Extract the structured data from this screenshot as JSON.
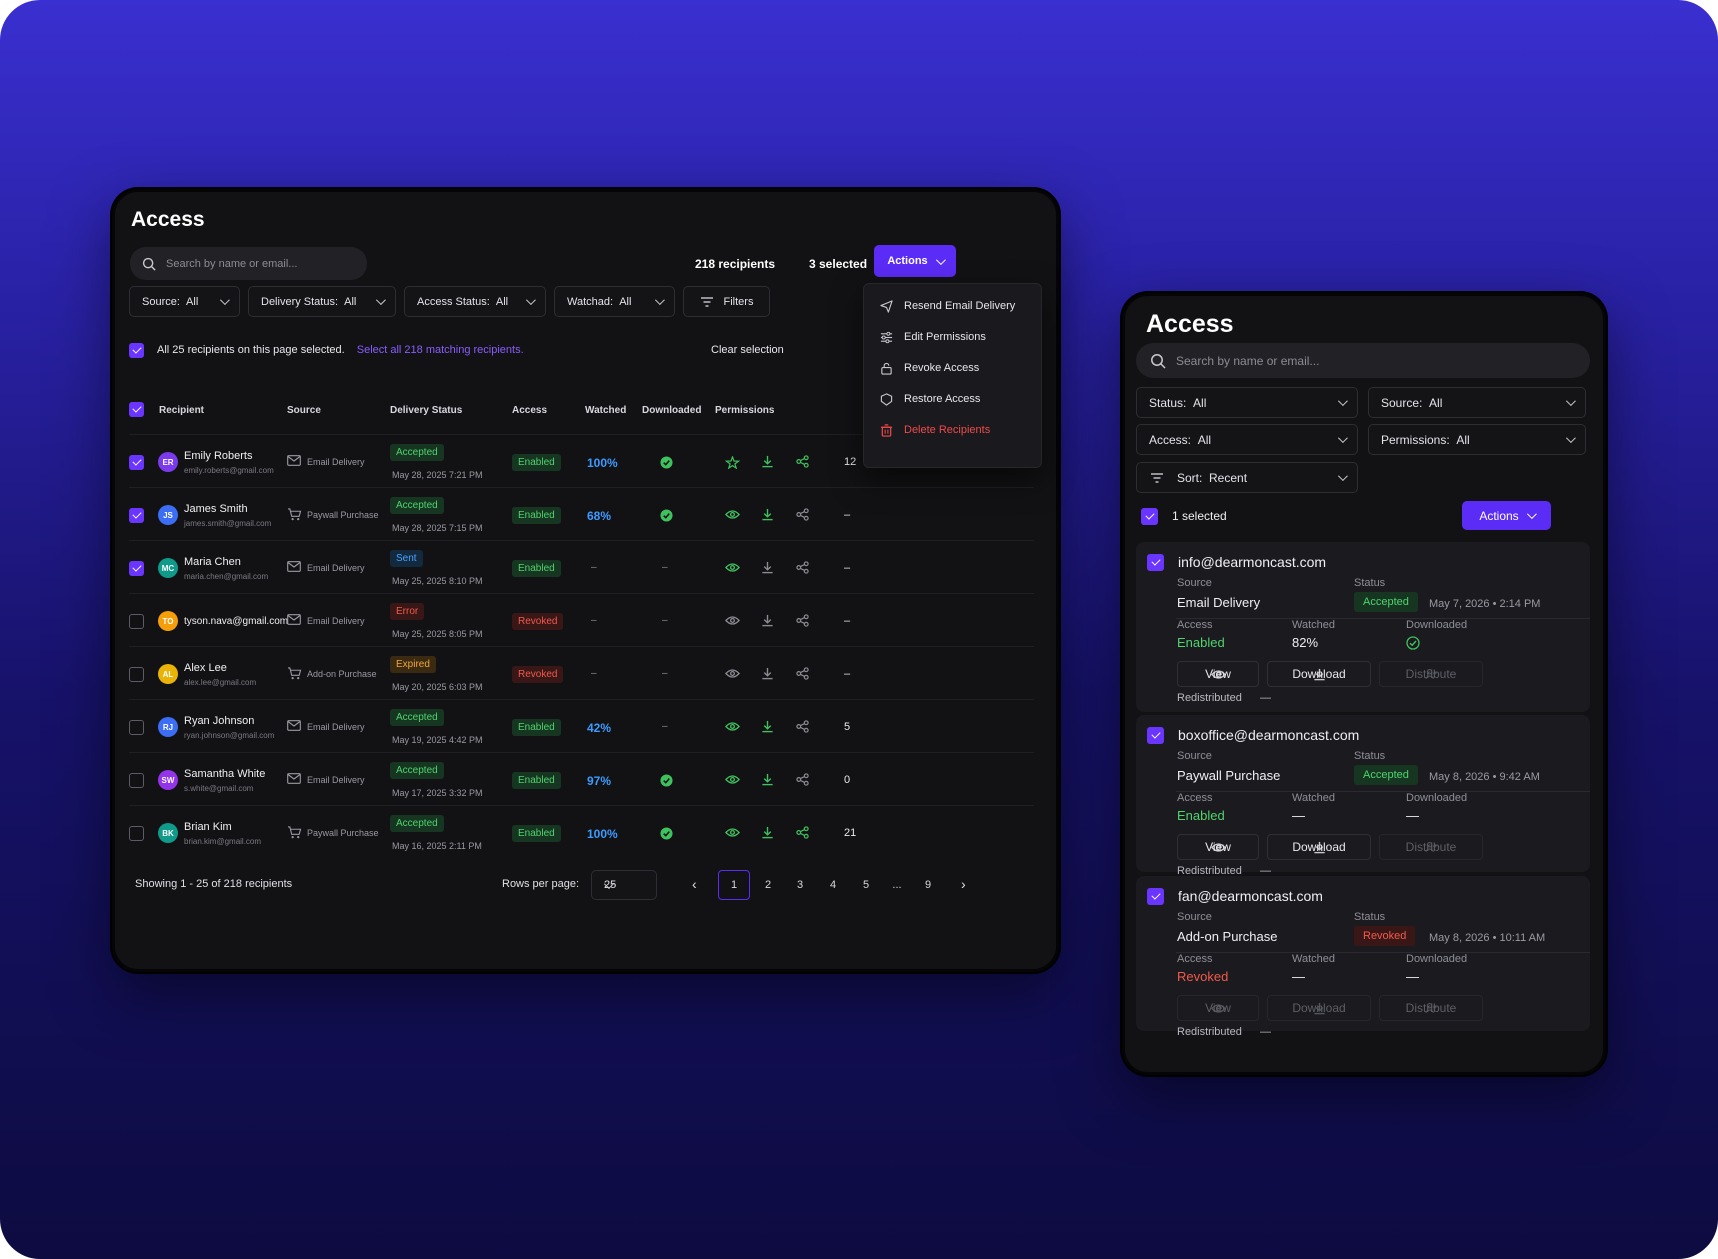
{
  "colors": {
    "accent": "#5b2cf5",
    "success": "#4fd36d",
    "danger": "#f05a4c",
    "info": "#4aa3ff",
    "warning": "#f0a53a"
  },
  "desktop": {
    "title": "Access",
    "search_placeholder": "Search by name or email...",
    "recipients_count": "218 recipients",
    "selected_count": "3 selected",
    "actions_label": "Actions",
    "filters": [
      {
        "label": "Source:",
        "value": "All"
      },
      {
        "label": "Delivery Status:",
        "value": "All"
      },
      {
        "label": "Access Status:",
        "value": "All"
      },
      {
        "label": "Watchad:",
        "value": "All"
      }
    ],
    "filters_button": "Filters",
    "selection_text": "All 25 recipients on this page selected.",
    "select_all_link": "Select all 218 matching recipients.",
    "clear_selection": "Clear selection",
    "menu": [
      {
        "label": "Resend Email Delivery",
        "icon": "send-icon"
      },
      {
        "label": "Edit Permissions",
        "icon": "sliders-icon"
      },
      {
        "label": "Revoke Access",
        "icon": "lock-open-icon"
      },
      {
        "label": "Restore Access",
        "icon": "shield-icon"
      },
      {
        "label": "Delete Recipients",
        "icon": "trash-icon"
      }
    ],
    "columns": [
      "Recipient",
      "Source",
      "Delivery Status",
      "Access",
      "Watched",
      "Downloaded",
      "Permissions"
    ],
    "rows": [
      {
        "initials": "ER",
        "avatar_color": "#7c3aed",
        "name": "Emily Roberts",
        "email": "emily.roberts@gmail.com",
        "source": "Email Delivery",
        "source_icon": "mail-icon",
        "status": "Accepted",
        "status_kind": "green",
        "date": "May 28, 2025 7:21 PM",
        "access": "Enabled",
        "access_kind": "green",
        "watched": "100%",
        "downloaded": "check",
        "perm_kind": "share-active",
        "count": "12",
        "checked": true
      },
      {
        "initials": "JS",
        "avatar_color": "#3b6ef5",
        "name": "James Smith",
        "email": "james.smith@gmail.com",
        "source": "Paywall Purchase",
        "source_icon": "cart-icon",
        "status": "Accepted",
        "status_kind": "green",
        "date": "May 28, 2025 7:15 PM",
        "access": "Enabled",
        "access_kind": "green",
        "watched": "68%",
        "downloaded": "check",
        "perm_kind": "view-download",
        "count": "–",
        "checked": true
      },
      {
        "initials": "MC",
        "avatar_color": "#0f9a8a",
        "name": "Maria Chen",
        "email": "maria.chen@gmail.com",
        "source": "Email Delivery",
        "source_icon": "mail-icon",
        "status": "Sent",
        "status_kind": "blue",
        "date": "May 25, 2025 8:10 PM",
        "access": "Enabled",
        "access_kind": "green",
        "watched": "–",
        "downloaded": "–",
        "perm_kind": "view",
        "count": "–",
        "checked": true
      },
      {
        "initials": "TO",
        "avatar_color": "#f59e0b",
        "name": "tyson.nava@gmail.com",
        "email": "",
        "source": "Email Delivery",
        "source_icon": "mail-icon",
        "status": "Error",
        "status_kind": "red",
        "date": "May 25, 2025 8:05 PM",
        "access": "Revoked",
        "access_kind": "red",
        "watched": "–",
        "downloaded": "–",
        "perm_kind": "none",
        "count": "–",
        "checked": false
      },
      {
        "initials": "AL",
        "avatar_color": "#eab308",
        "name": "Alex Lee",
        "email": "alex.lee@gmail.com",
        "source": "Add-on Purchase",
        "source_icon": "cart-icon",
        "status": "Expired",
        "status_kind": "orange",
        "date": "May 20, 2025 6:03 PM",
        "access": "Revoked",
        "access_kind": "red",
        "watched": "–",
        "downloaded": "–",
        "perm_kind": "none",
        "count": "–",
        "checked": false
      },
      {
        "initials": "RJ",
        "avatar_color": "#3b6ef5",
        "name": "Ryan Johnson",
        "email": "ryan.johnson@gmail.com",
        "source": "Email Delivery",
        "source_icon": "mail-icon",
        "status": "Accepted",
        "status_kind": "green",
        "date": "May 19, 2025 4:42 PM",
        "access": "Enabled",
        "access_kind": "green",
        "watched": "42%",
        "downloaded": "–",
        "perm_kind": "view-download",
        "count": "5",
        "checked": false
      },
      {
        "initials": "SW",
        "avatar_color": "#9333ea",
        "name": "Samantha White",
        "email": "s.white@gmail.com",
        "source": "Email Delivery",
        "source_icon": "mail-icon",
        "status": "Accepted",
        "status_kind": "green",
        "date": "May 17, 2025 3:32 PM",
        "access": "Enabled",
        "access_kind": "green",
        "watched": "97%",
        "downloaded": "check",
        "perm_kind": "view-download",
        "count": "0",
        "checked": false
      },
      {
        "initials": "BK",
        "avatar_color": "#0f9a8a",
        "name": "Brian Kim",
        "email": "brian.kim@gmail.com",
        "source": "Paywall Purchase",
        "source_icon": "cart-icon",
        "status": "Accepted",
        "status_kind": "green",
        "date": "May 16, 2025 2:11 PM",
        "access": "Enabled",
        "access_kind": "green",
        "watched": "100%",
        "downloaded": "check",
        "perm_kind": "all",
        "count": "21",
        "checked": false
      }
    ],
    "footer": {
      "showing": "Showing 1 - 25 of 218 recipients",
      "rows_per_page_label": "Rows per page:",
      "rows_per_page_value": "25",
      "pages": [
        "1",
        "2",
        "3",
        "4",
        "5",
        "...",
        "9"
      ],
      "current_page": "1"
    }
  },
  "mobile": {
    "title": "Access",
    "search_placeholder": "Search by name or email...",
    "filters": [
      {
        "label": "Status:",
        "value": "All"
      },
      {
        "label": "Source:",
        "value": "All"
      },
      {
        "label": "Access:",
        "value": "All"
      },
      {
        "label": "Permissions:",
        "value": "All"
      }
    ],
    "sort": {
      "label": "Sort:",
      "value": "Recent"
    },
    "selected_text": "1 selected",
    "actions_label": "Actions",
    "labels": {
      "source": "Source",
      "status": "Status",
      "access": "Access",
      "watched": "Watched",
      "downloaded": "Downloaded",
      "redistributed": "Redistributed",
      "view": "View",
      "download": "Download",
      "distribute": "Distribute"
    },
    "cards": [
      {
        "email": "info@dearmoncast.com",
        "source": "Email Delivery",
        "status": "Accepted",
        "status_kind": "green",
        "date": "May 7, 2026 • 2:14 PM",
        "access": "Enabled",
        "access_kind": "green",
        "watched": "82%",
        "downloaded": "check",
        "redistributed": "—",
        "buttons_enabled": true
      },
      {
        "email": "boxoffice@dearmoncast.com",
        "source": "Paywall Purchase",
        "status": "Accepted",
        "status_kind": "green",
        "date": "May 8, 2026 • 9:42 AM",
        "access": "Enabled",
        "access_kind": "green",
        "watched": "—",
        "downloaded": "—",
        "redistributed": "—",
        "buttons_enabled": true
      },
      {
        "email": "fan@dearmoncast.com",
        "source": "Add-on Purchase",
        "status": "Revoked",
        "status_kind": "red",
        "date": "May 8, 2026 • 10:11 AM",
        "access": "Revoked",
        "access_kind": "red",
        "watched": "—",
        "downloaded": "—",
        "redistributed": "—",
        "buttons_enabled": false
      }
    ]
  }
}
